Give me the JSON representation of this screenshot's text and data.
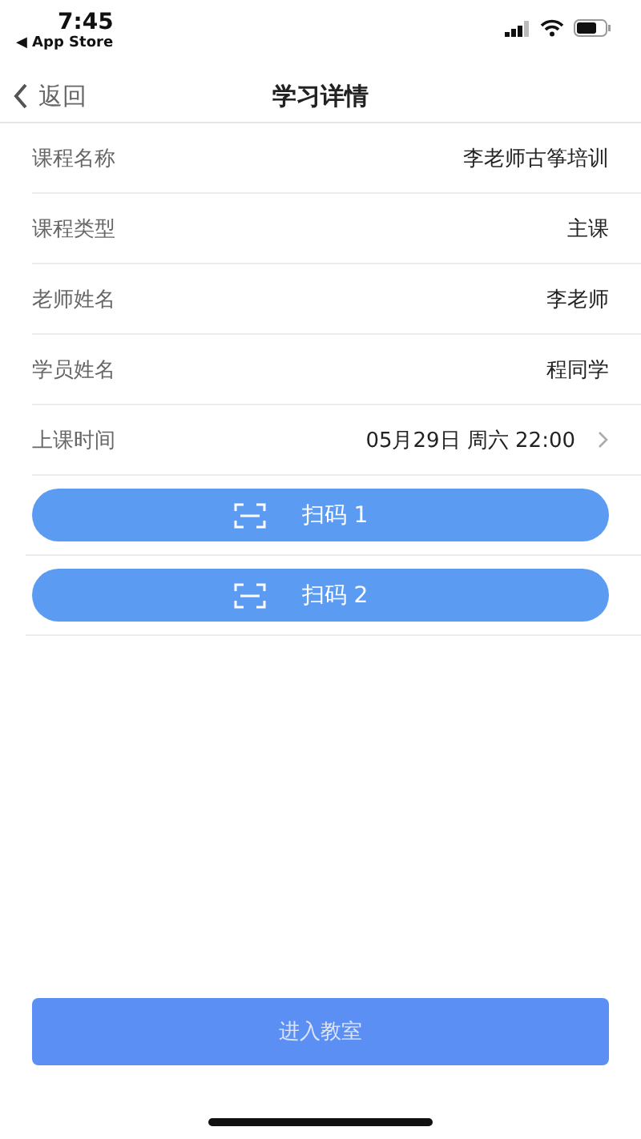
{
  "status_bar": {
    "time": "7:45",
    "back_app": "◀ App Store"
  },
  "nav": {
    "back": "返回",
    "title": "学习详情"
  },
  "details": [
    {
      "kind": "plain",
      "label": "课程名称",
      "value": "李老师古筝培训"
    },
    {
      "kind": "plain",
      "label": "课程类型",
      "value": "主课"
    },
    {
      "kind": "plain",
      "label": "老师姓名",
      "value": "李老师"
    },
    {
      "kind": "plain",
      "label": "学员姓名",
      "value": "程同学"
    },
    {
      "kind": "link",
      "label": "上课时间",
      "value": "05月29日 周六 22:00"
    }
  ],
  "scan_buttons": [
    "扫码 1",
    "扫码 2"
  ],
  "enter_button": "进入教室"
}
